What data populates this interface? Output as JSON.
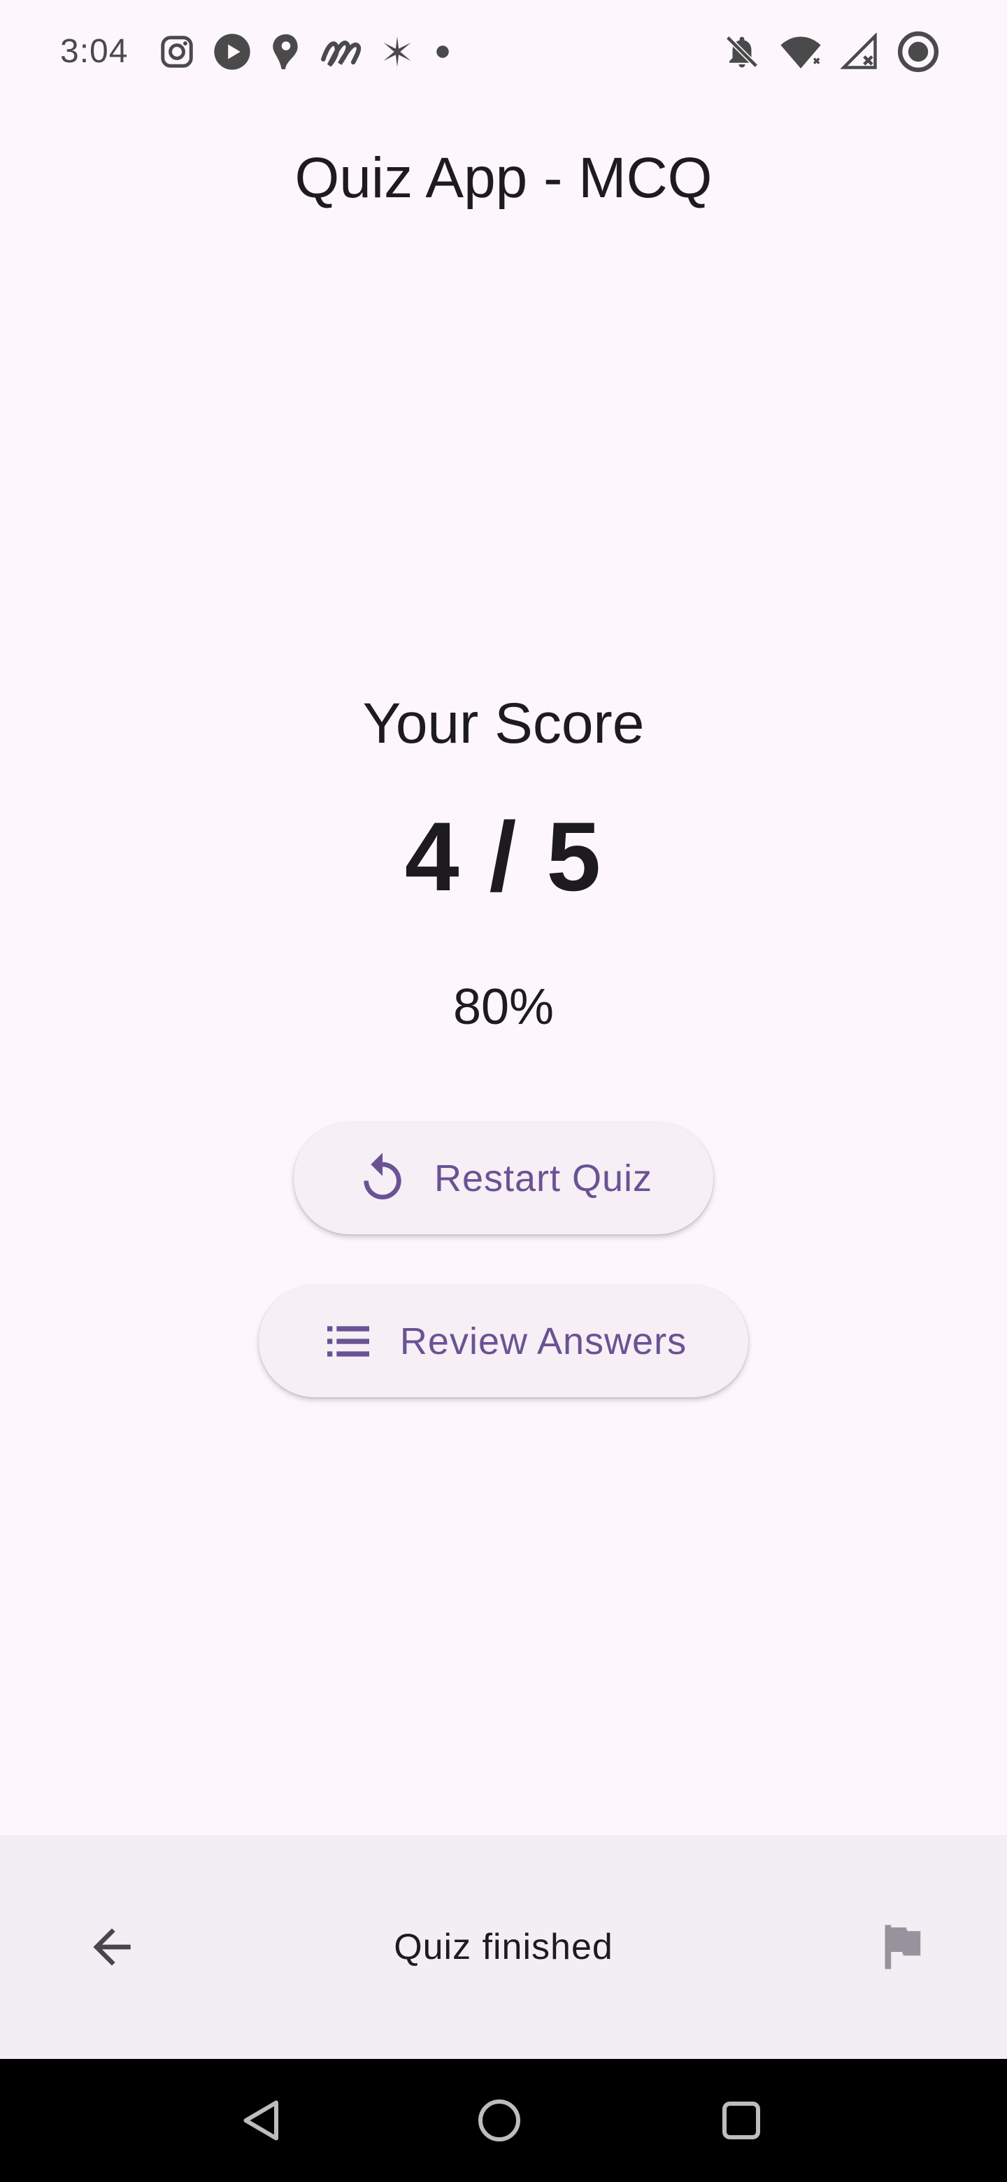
{
  "status_bar": {
    "time": "3:04",
    "left_icons": [
      "instagram-icon",
      "play-icon",
      "map-pin-icon",
      "app-logo-icon",
      "sparkle-icon",
      "dot-icon"
    ],
    "right_icons": [
      "notifications-off-icon",
      "wifi-icon",
      "no-signal-icon",
      "status-ring-icon"
    ]
  },
  "header": {
    "title": "Quiz App - MCQ"
  },
  "score": {
    "heading": "Your Score",
    "value": "4 / 5",
    "percent": "80%",
    "correct": 4,
    "total": 5
  },
  "actions": {
    "restart_label": "Restart Quiz",
    "restart_icon": "refresh-icon",
    "review_label": "Review Answers",
    "review_icon": "list-icon"
  },
  "bottom_bar": {
    "back_icon": "arrow-back-icon",
    "status_text": "Quiz finished",
    "flag_icon": "flag-icon"
  },
  "system_nav": {
    "buttons": [
      "nav-back-icon",
      "nav-home-icon",
      "nav-recents-icon"
    ]
  },
  "colors": {
    "background": "#fdf7fd",
    "accent": "#6a5294",
    "button_surface": "#f6eff5",
    "bottom_bar": "#f2eef4",
    "text": "#1d1b20",
    "nav_bar": "#000000"
  }
}
